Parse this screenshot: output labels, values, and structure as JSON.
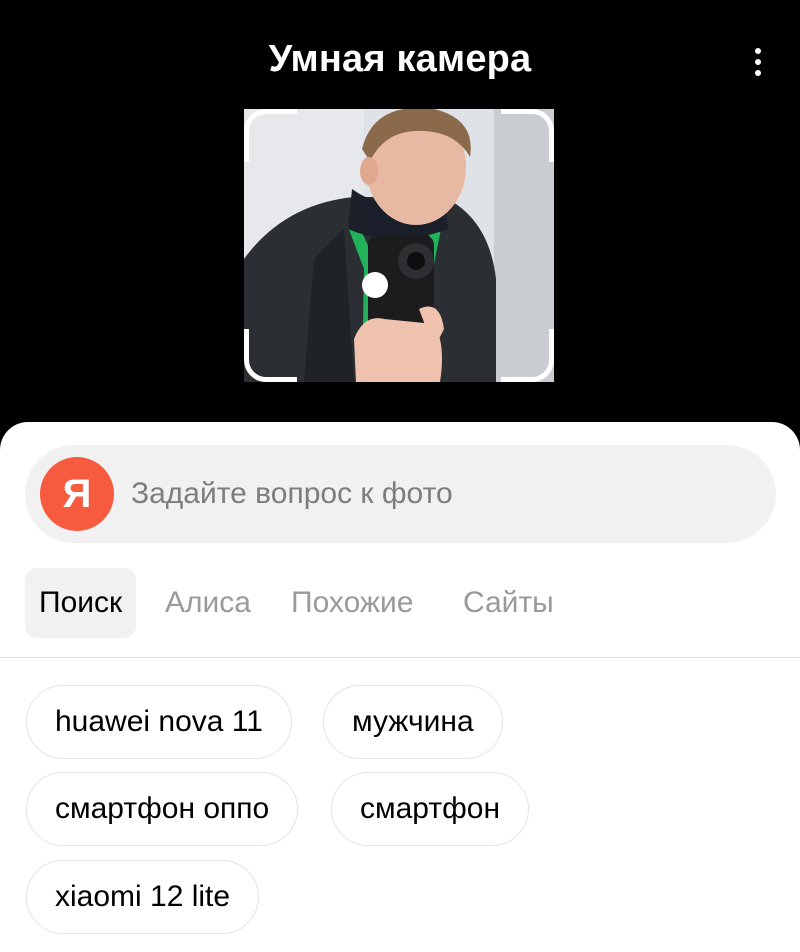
{
  "header": {
    "title": "Умная камера",
    "menu_icon": "more-vertical-icon"
  },
  "ask": {
    "logo_letter": "Я",
    "placeholder": "Задайте вопрос к фото"
  },
  "tabs": [
    {
      "label": "Поиск",
      "active": true
    },
    {
      "label": "Алиса",
      "active": false
    },
    {
      "label": "Похожие",
      "active": false
    },
    {
      "label": "Сайты",
      "active": false
    }
  ],
  "chips": [
    {
      "label": "huawei nova 11"
    },
    {
      "label": "мужчина"
    },
    {
      "label": "смартфон оппо"
    },
    {
      "label": "смартфон"
    },
    {
      "label": "xiaomi 12 lite"
    }
  ],
  "colors": {
    "yandex_red": "#f65a3f",
    "background_dark": "#000000",
    "sheet": "#ffffff"
  }
}
